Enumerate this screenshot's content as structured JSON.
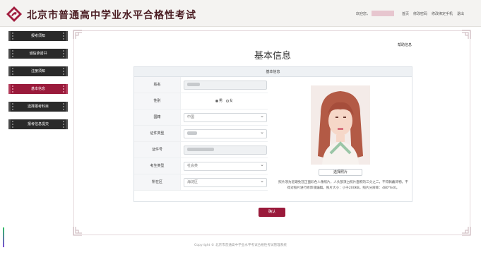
{
  "header": {
    "title": "北京市普通高中学业水平合格性考试",
    "welcome": "欢迎您，",
    "links": [
      "首页",
      "修改密码",
      "修改绑定手机",
      "退出"
    ]
  },
  "sidebar": {
    "items": [
      {
        "label": "报考须知",
        "active": false
      },
      {
        "label": "诚信承诺书",
        "active": false
      },
      {
        "label": "注册须知",
        "active": false
      },
      {
        "label": "基本信息",
        "active": true
      },
      {
        "label": "选择报考科目",
        "active": false
      },
      {
        "label": "报考信息提交",
        "active": false
      }
    ]
  },
  "main": {
    "help_link": "帮助信息",
    "heading": "基本信息",
    "card_title": "基本信息",
    "fields": {
      "name": {
        "label": "姓名"
      },
      "gender": {
        "label": "性别",
        "options": [
          "男",
          "女"
        ],
        "selected": "男"
      },
      "nationality": {
        "label": "国籍",
        "value": "中国"
      },
      "id_type": {
        "label": "证件类型"
      },
      "id_number": {
        "label": "证件号"
      },
      "candidate_type": {
        "label": "考生类型",
        "value": "社会类"
      },
      "district": {
        "label": "所在区",
        "value": "海淀区"
      }
    },
    "upload_button": "选择照片",
    "photo_hint": "照片须为近期免冠正面彩色人像照片，人头部须占照片面积的三分之二，不得佩戴饰物，不得对照片进行修饰或编辑。照片大小：小于200KB，照片分辨率：480*640。",
    "confirm_button": "确认"
  },
  "footer": "Copyright © 北京市普通高中学业水平考试合格性考试管理系统",
  "colors": {
    "accent": "#9a1a3b",
    "sidebar_bg": "#2a2a2a",
    "title": "#4a1c22"
  }
}
